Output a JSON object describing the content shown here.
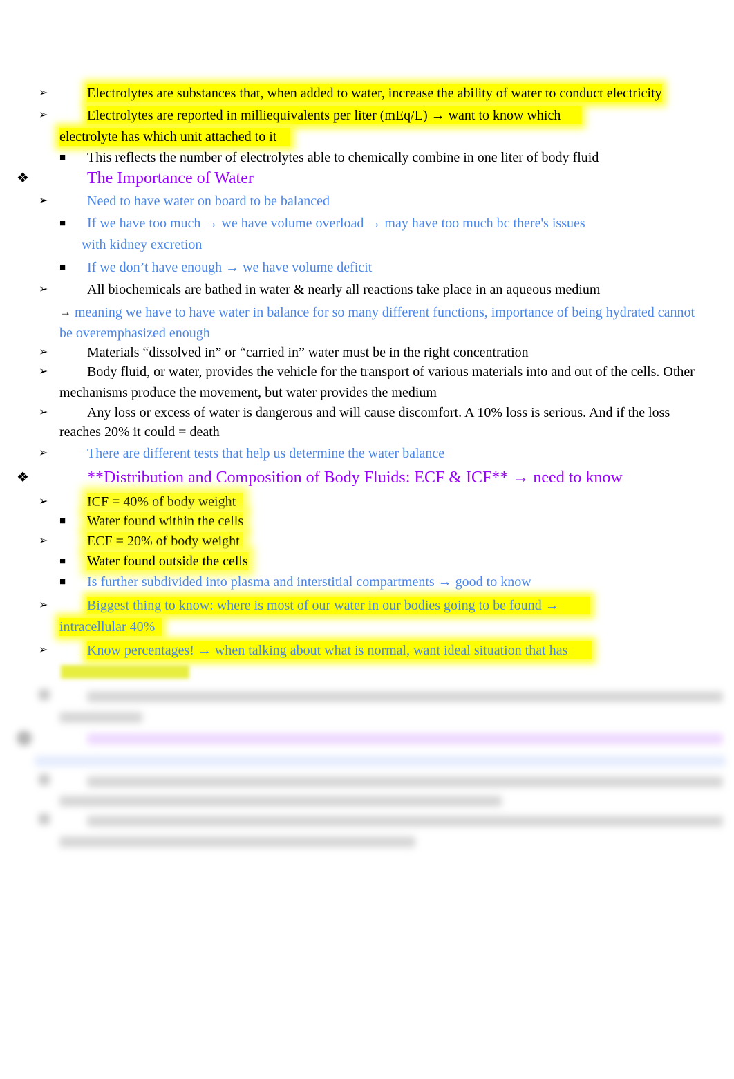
{
  "document": {
    "lines": {
      "l1": "Electrolytes are substances that, when added to water, increase the ability of water to conduct electricity",
      "l2a": "Electrolytes are reported in milliequivalents per liter (mEq/L) → want to know which",
      "l2b": "electrolyte has which unit attached to it",
      "l3": "This reflects the number of electrolytes able to chemically combine in one liter of body fluid",
      "h1": "The Importance of Water",
      "l4": "Need to have water on board to be balanced",
      "l5a": "If we have too much → we have volume overload → may have too much bc there's issues",
      "l5b": "with kidney excretion",
      "l6": "If we don’t have enough → we have volume deficit",
      "l7": "All biochemicals are bathed in water & nearly all reactions take place in an aqueous medium",
      "l8a_arrow": "→",
      "l8a": "meaning we have to have water in balance for so many different functions, importance of being hydrated cannot",
      "l8b": "be overemphasized enough",
      "l9": "Materials “dissolved in” or “carried in” water must be in the right concentration",
      "l10a": "Body fluid, or water, provides the vehicle for the transport of various materials into and out of the cells. Other",
      "l10b": "mechanisms produce the movement, but water provides the medium",
      "l11a": "Any loss or excess of water is dangerous and will cause discomfort. A 10% loss is serious. And if the loss",
      "l11b": "reaches 20% it could = death",
      "l12": "There are different tests that help us determine the water balance",
      "h2": "**Distribution and Composition of Body Fluids: ECF & ICF** → need to know",
      "l13": "ICF = 40% of body weight",
      "l14": "Water found within the cells",
      "l15": "ECF = 20% of body weight",
      "l16": "Water found outside the cells",
      "l17": "Is further subdivided into plasma and interstitial compartments → good to know",
      "l18a": "Biggest thing to know: where is most of our water in our bodies going to be found →",
      "l18b": "intracellular 40%",
      "l19a": "Know percentages! → when talking about what is normal, want ideal situation that has"
    },
    "bullets": {
      "arrow": "➢",
      "square": "■",
      "diamond": "❖"
    },
    "colors": {
      "text": "#000000",
      "blue_note": "#4a86e8",
      "purple_heading": "#9900ff",
      "highlight": "#ffff00"
    }
  }
}
